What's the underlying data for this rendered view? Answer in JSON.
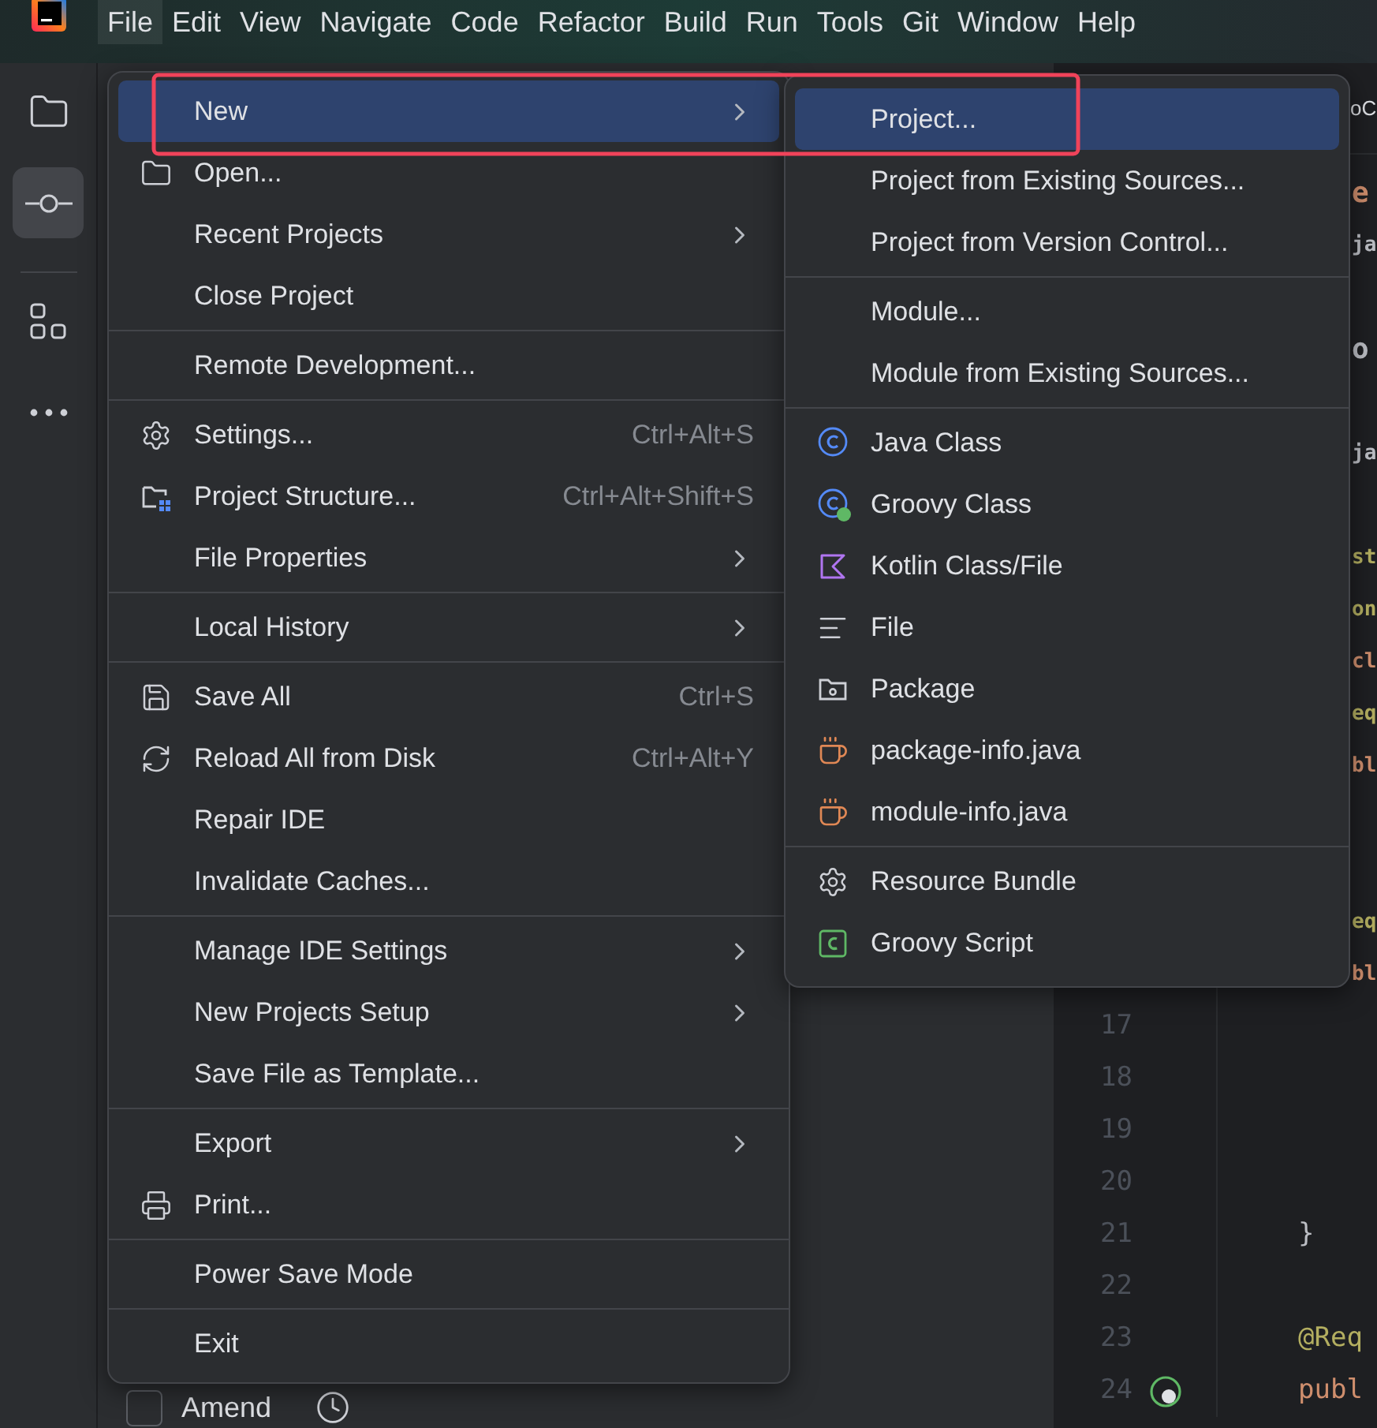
{
  "menu_bar": [
    {
      "label": "File",
      "selected": true
    },
    {
      "label": "Edit",
      "selected": false
    },
    {
      "label": "View",
      "selected": false
    },
    {
      "label": "Navigate",
      "selected": false
    },
    {
      "label": "Code",
      "selected": false
    },
    {
      "label": "Refactor",
      "selected": false
    },
    {
      "label": "Build",
      "selected": false
    },
    {
      "label": "Run",
      "selected": false
    },
    {
      "label": "Tools",
      "selected": false
    },
    {
      "label": "Git",
      "selected": false
    },
    {
      "label": "Window",
      "selected": false
    },
    {
      "label": "Help",
      "selected": false
    }
  ],
  "tool_strip": [
    {
      "selected": false
    },
    {
      "selected": true
    },
    {
      "selected": false
    },
    {
      "selected": false
    }
  ],
  "commit_panel": {
    "amend": {
      "label": "Amend",
      "checked": false
    }
  },
  "editor": {
    "tab": "oC",
    "lines": [
      {
        "kind": "clipped",
        "code": "e",
        "color": "#cf8e6d"
      },
      {
        "kind": "clipped",
        "code": "ja",
        "color": "#bcbec4"
      },
      {
        "kind": "blank"
      },
      {
        "kind": "clipped",
        "code": "o",
        "color": "#bcbec4"
      },
      {
        "kind": "blank"
      },
      {
        "kind": "clipped",
        "code": "ja",
        "color": "#bcbec4"
      },
      {
        "kind": "blank"
      },
      {
        "kind": "clipped",
        "code": "st",
        "color": "#b3ae60"
      },
      {
        "kind": "clipped",
        "code": "on",
        "color": "#b3ae60"
      },
      {
        "kind": "clipped",
        "code": "cl",
        "color": "#cf8e6d"
      },
      {
        "kind": "clipped",
        "code": "eq",
        "color": "#b3ae60"
      },
      {
        "kind": "clipped",
        "code": "bl",
        "color": "#cf8e6d"
      },
      {
        "kind": "blank"
      },
      {
        "kind": "blank"
      },
      {
        "kind": "clipped",
        "code": "eq",
        "color": "#b3ae60"
      },
      {
        "kind": "clipped",
        "code": "bl",
        "color": "#cf8e6d"
      },
      {
        "kind": "full",
        "number": "17",
        "marker": false
      },
      {
        "kind": "full",
        "number": "18",
        "marker": false
      },
      {
        "kind": "full",
        "number": "19",
        "marker": false
      },
      {
        "kind": "full",
        "number": "20",
        "marker": false
      },
      {
        "kind": "full",
        "number": "21",
        "marker": false,
        "code": "}",
        "color": "#bcbec4"
      },
      {
        "kind": "full",
        "number": "22",
        "marker": false
      },
      {
        "kind": "full",
        "number": "23",
        "marker": false,
        "code": "@Req",
        "color": "#b3ae60"
      },
      {
        "kind": "full",
        "number": "24",
        "marker": true,
        "code": "publ",
        "color": "#cf8e6d"
      }
    ]
  },
  "file_menu": {
    "groups": [
      {
        "items": [
          {
            "label": "New",
            "submenu": true,
            "selected": true
          },
          {
            "label": "Open...",
            "submenu": false,
            "selected": false
          },
          {
            "label": "Recent Projects",
            "submenu": true,
            "selected": false
          },
          {
            "label": "Close Project",
            "submenu": false,
            "selected": false
          }
        ]
      },
      {
        "items": [
          {
            "label": "Remote Development...",
            "submenu": false,
            "selected": false
          }
        ]
      },
      {
        "items": [
          {
            "label": "Settings...",
            "shortcut": "Ctrl+Alt+S",
            "submenu": false,
            "selected": false
          },
          {
            "label": "Project Structure...",
            "shortcut": "Ctrl+Alt+Shift+S",
            "submenu": false,
            "selected": false
          },
          {
            "label": "File Properties",
            "submenu": true,
            "selected": false
          }
        ]
      },
      {
        "items": [
          {
            "label": "Local History",
            "submenu": true,
            "selected": false
          }
        ]
      },
      {
        "items": [
          {
            "label": "Save All",
            "shortcut": "Ctrl+S",
            "submenu": false,
            "selected": false
          },
          {
            "label": "Reload All from Disk",
            "shortcut": "Ctrl+Alt+Y",
            "submenu": false,
            "selected": false
          },
          {
            "label": "Repair IDE",
            "submenu": false,
            "selected": false
          },
          {
            "label": "Invalidate Caches...",
            "submenu": false,
            "selected": false
          }
        ]
      },
      {
        "items": [
          {
            "label": "Manage IDE Settings",
            "submenu": true,
            "selected": false
          },
          {
            "label": "New Projects Setup",
            "submenu": true,
            "selected": false
          },
          {
            "label": "Save File as Template...",
            "submenu": false,
            "selected": false
          }
        ]
      },
      {
        "items": [
          {
            "label": "Export",
            "submenu": true,
            "selected": false
          },
          {
            "label": "Print...",
            "submenu": false,
            "selected": false
          }
        ]
      },
      {
        "items": [
          {
            "label": "Power Save Mode",
            "submenu": false,
            "selected": false
          }
        ]
      },
      {
        "items": [
          {
            "label": "Exit",
            "submenu": false,
            "selected": false
          }
        ]
      }
    ]
  },
  "new_submenu": {
    "groups": [
      {
        "items": [
          {
            "label": "Project...",
            "selected": true
          },
          {
            "label": "Project from Existing Sources...",
            "selected": false
          },
          {
            "label": "Project from Version Control...",
            "selected": false
          }
        ]
      },
      {
        "items": [
          {
            "label": "Module...",
            "selected": false
          },
          {
            "label": "Module from Existing Sources...",
            "selected": false
          }
        ]
      },
      {
        "items": [
          {
            "label": "Java Class",
            "selected": false
          },
          {
            "label": "Groovy Class",
            "selected": false
          },
          {
            "label": "Kotlin Class/File",
            "selected": false
          },
          {
            "label": "File",
            "selected": false
          },
          {
            "label": "Package",
            "selected": false
          },
          {
            "label": "package-info.java",
            "selected": false
          },
          {
            "label": "module-info.java",
            "selected": false
          }
        ]
      },
      {
        "items": [
          {
            "label": "Resource Bundle",
            "selected": false
          },
          {
            "label": "Groovy Script",
            "selected": false
          }
        ]
      }
    ]
  }
}
